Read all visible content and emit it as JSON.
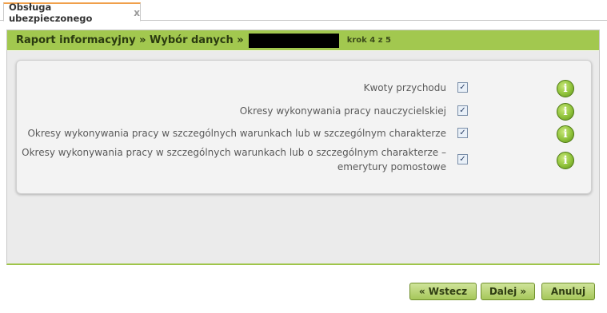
{
  "tab": {
    "label": "Obsługa ubezpieczonego",
    "close": "x"
  },
  "header": {
    "title": "Raport informacyjny » Wybór danych »",
    "step": "krok 4 z 5"
  },
  "options": [
    {
      "label": "Kwoty przychodu",
      "checked": true
    },
    {
      "label": "Okresy wykonywania pracy nauczycielskiej",
      "checked": true
    },
    {
      "label": "Okresy wykonywania pracy w szczególnych warunkach lub w szczególnym charakterze",
      "checked": true
    },
    {
      "label_line1": "Okresy wykonywania pracy w szczególnych warunkach lub o szczególnym charakterze –",
      "label_line2": "emerytury pomostowe",
      "checked": true
    }
  ],
  "buttons": {
    "back": "« Wstecz",
    "next": "Dalej »",
    "cancel": "Anuluj"
  },
  "icons": {
    "check": "✓",
    "info": "i"
  },
  "colors": {
    "accent": "#a2c84f",
    "tab_highlight": "#f0a04b"
  }
}
